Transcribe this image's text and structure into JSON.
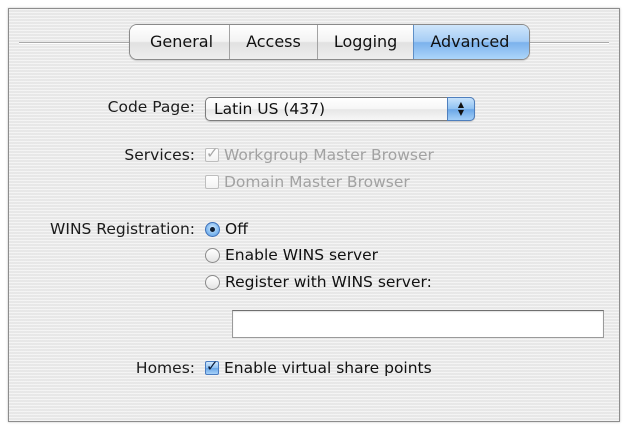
{
  "tabs": [
    {
      "label": "General",
      "selected": false
    },
    {
      "label": "Access",
      "selected": false
    },
    {
      "label": "Logging",
      "selected": false
    },
    {
      "label": "Advanced",
      "selected": true
    }
  ],
  "code_page": {
    "label": "Code Page:",
    "value": "Latin US (437)"
  },
  "services": {
    "label": "Services:",
    "workgroup_master_browser": {
      "label": "Workgroup Master Browser",
      "checked": true,
      "enabled": false
    },
    "domain_master_browser": {
      "label": "Domain Master Browser",
      "checked": false,
      "enabled": false
    }
  },
  "wins": {
    "label": "WINS Registration:",
    "options": [
      {
        "label": "Off",
        "selected": true
      },
      {
        "label": "Enable WINS server",
        "selected": false
      },
      {
        "label": "Register with WINS server:",
        "selected": false
      }
    ],
    "server_value": ""
  },
  "homes": {
    "label": "Homes:",
    "virtual_share_points": {
      "label": "Enable virtual share points",
      "checked": true
    }
  },
  "colors": {
    "selected_tab": "#8fc1f2",
    "disabled_text": "#a2a2a2",
    "panel_background": "#ececec"
  }
}
